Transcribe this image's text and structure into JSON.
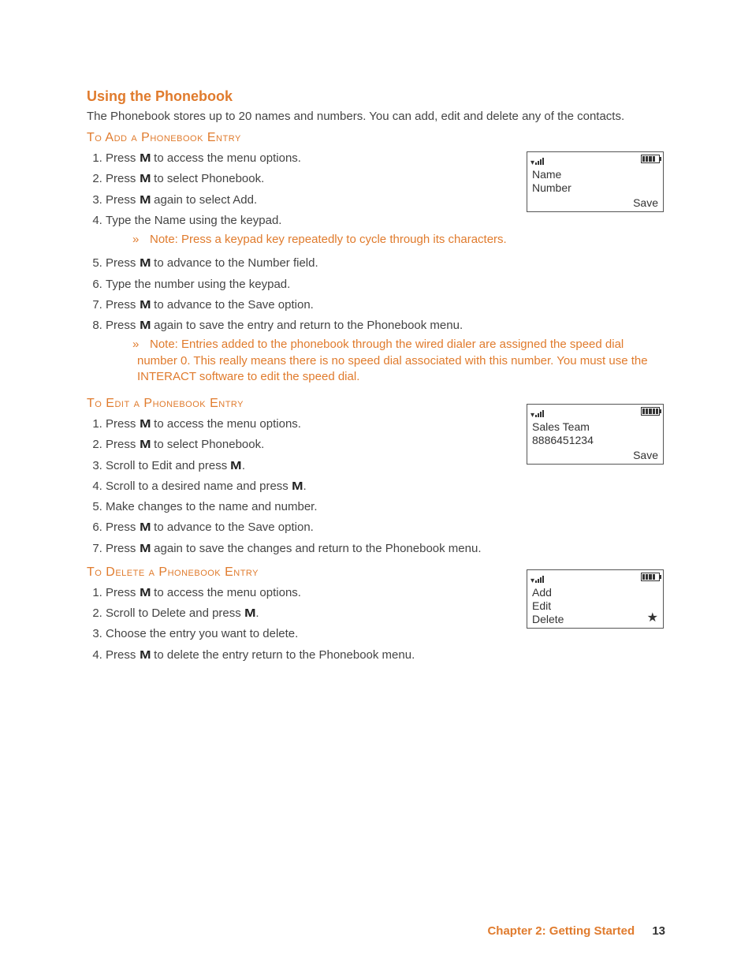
{
  "heading": "Using the Phonebook",
  "intro": "The Phonebook stores up to 20 names and numbers. You can add, edit and delete any of the contacts.",
  "sub_add": "To Add a Phonebook Entry",
  "sub_edit": "To Edit a Phonebook Entry",
  "sub_delete": "To Delete a Phonebook Entry",
  "m": "M",
  "add_steps": {
    "s1a": "Press ",
    "s1b": " to access the menu options.",
    "s2a": "Press ",
    "s2b": " to select Phonebook.",
    "s3a": "Press ",
    "s3b": " again to select Add.",
    "s4": "Type the Name using the keypad.",
    "note1": "Note: Press a keypad key repeatedly to cycle through its characters.",
    "s5a": "Press ",
    "s5b": " to advance to the Number field.",
    "s6": "Type the number using the keypad.",
    "s7a": "Press ",
    "s7b": " to advance to the Save option.",
    "s8a": "Press ",
    "s8b": " again to save the entry and return to the Phonebook menu.",
    "note2": "Note: Entries added to the phonebook through the wired dialer are assigned the speed dial number 0. This really means there is no speed dial associated with this number. You must use the INTERACT software to edit the speed dial."
  },
  "edit_steps": {
    "s1a": "Press ",
    "s1b": " to access the menu options.",
    "s2a": "Press ",
    "s2b": " to select Phonebook.",
    "s3a": "Scroll to Edit and press ",
    "s3b": ".",
    "s4a": "Scroll to a desired name and press ",
    "s4b": ".",
    "s5": "Make changes to the name and number.",
    "s6a": "Press ",
    "s6b": " to advance to the Save option.",
    "s7a": "Press ",
    "s7b": " again to save the changes and return to the Phonebook menu."
  },
  "del_steps": {
    "s1a": "Press ",
    "s1b": " to access the menu options.",
    "s2a": "Scroll to Delete and press ",
    "s2b": ".",
    "s3": "Choose the entry you want to delete.",
    "s4a": "Press ",
    "s4b": " to delete the entry return to the Phonebook menu."
  },
  "device1": {
    "line1": "Name",
    "line2": "Number",
    "save": "Save"
  },
  "device2": {
    "line1": "Sales Team",
    "line2": "8886451234",
    "save": "Save"
  },
  "device3": {
    "line1": "Add",
    "line2": "Edit",
    "line3": "Delete",
    "star": "★"
  },
  "footer": {
    "chapter": "Chapter 2: Getting Started",
    "page": "13"
  },
  "raquo": "»"
}
